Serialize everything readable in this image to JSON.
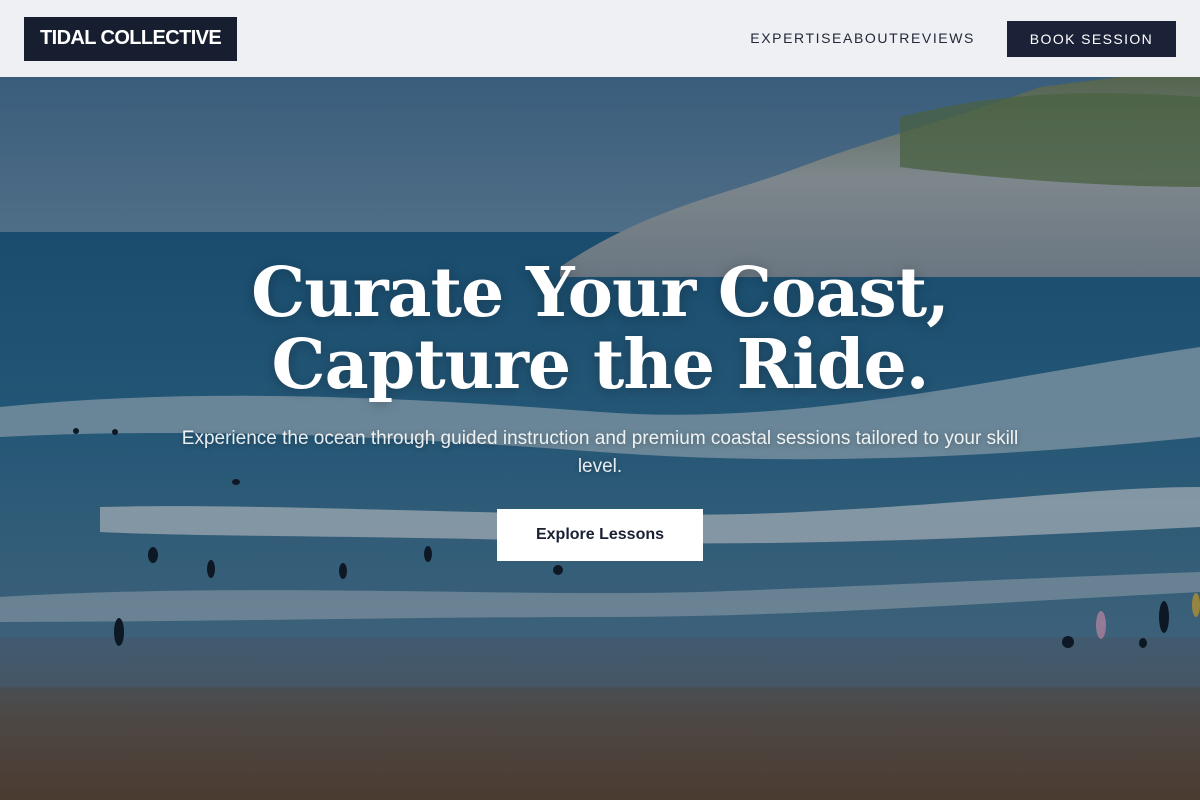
{
  "nav": {
    "logo": "TIDAL COLLECTIVE",
    "links": [
      {
        "label": "EXPERTISE"
      },
      {
        "label": "ABOUT"
      },
      {
        "label": "REVIEWS"
      }
    ],
    "cta": "BOOK SESSION"
  },
  "hero": {
    "title_line1": "Curate Your Coast,",
    "title_line2": "Capture the Ride.",
    "subtitle": "Experience the ocean through guided instruction and premium coastal sessions tailored to your skill level.",
    "cta": "Explore Lessons",
    "background_image": "beach-surf-scene"
  },
  "colors": {
    "nav_bg": "#eef0f3",
    "logo_bg": "#171e30",
    "cta_nav_bg": "#1b2238",
    "hero_cta_bg": "#ffffff"
  }
}
